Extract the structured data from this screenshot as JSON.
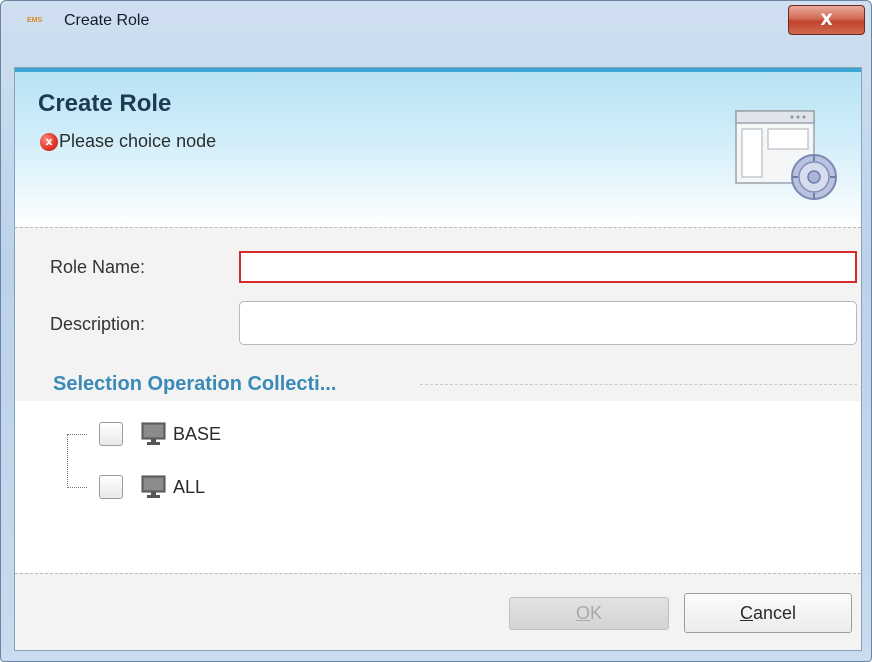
{
  "window": {
    "app_icon_text": "EMS",
    "title": "Create Role",
    "close_symbol": "X"
  },
  "banner": {
    "title": "Create Role",
    "error_icon_glyph": "x",
    "message": "Please choice node",
    "graphic_icon": "window-settings-icon"
  },
  "form": {
    "role_name_label": "Role Name:",
    "role_name_value": "",
    "description_label": "Description:",
    "description_value": ""
  },
  "section": {
    "title": "Selection Operation Collecti..."
  },
  "tree": {
    "nodes": [
      {
        "label": "BASE",
        "checked": false,
        "icon": "monitor-icon"
      },
      {
        "label": "ALL",
        "checked": false,
        "icon": "monitor-icon"
      }
    ]
  },
  "buttons": {
    "ok_mnemonic": "O",
    "ok_rest": "K",
    "cancel_mnemonic": "C",
    "cancel_rest": "ancel"
  },
  "colors": {
    "error": "#d62a2a",
    "section_title": "#3a8ab8",
    "banner_top": "#3da5d1"
  }
}
